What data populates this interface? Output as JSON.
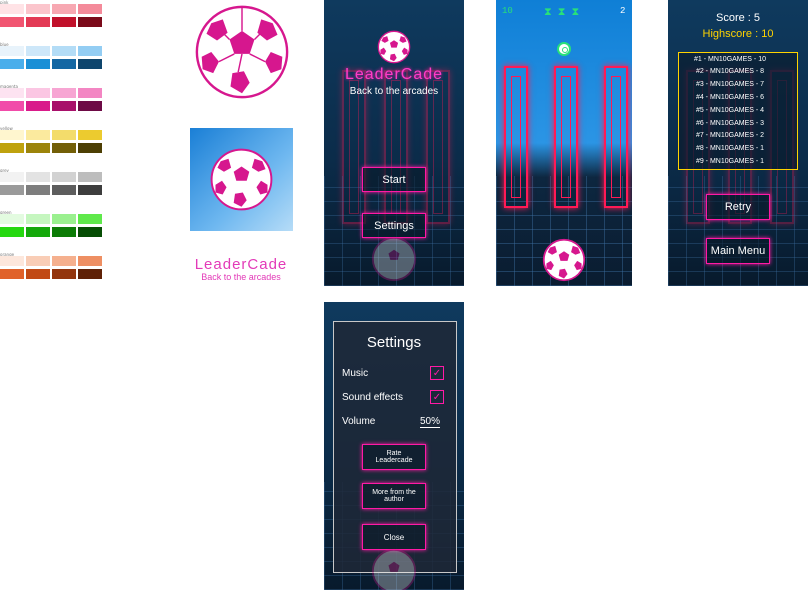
{
  "palette": {
    "groups": [
      {
        "title": "pink",
        "rows": [
          [
            "#ffe3e6",
            "#fbc5cc",
            "#f7a8b2",
            "#f48a9a"
          ],
          [
            "#f15571",
            "#e33a55",
            "#c1112b",
            "#7b0a1a"
          ]
        ]
      },
      {
        "title": "blue",
        "rows": [
          [
            "#e8f3fb",
            "#cde7f9",
            "#b3dcf6",
            "#93cdf3"
          ],
          [
            "#4aaeeb",
            "#1a8fd6",
            "#1467a3",
            "#0e456d"
          ]
        ]
      },
      {
        "title": "magenta",
        "rows": [
          [
            "#fde3f1",
            "#fbc6e3",
            "#f7a5d3",
            "#f386c3"
          ],
          [
            "#f14ca9",
            "#d91b8a",
            "#a8106a",
            "#6d0a45"
          ]
        ]
      },
      {
        "title": "yellow",
        "rows": [
          [
            "#fff6cf",
            "#fbea9e",
            "#f3dc6b",
            "#eccb2f"
          ],
          [
            "#bfa20e",
            "#9c840b",
            "#735f07",
            "#4d3f04"
          ]
        ]
      },
      {
        "title": "grey",
        "rows": [
          [
            "#f2f2f2",
            "#e3e3e3",
            "#d2d2d2",
            "#bdbdbd"
          ],
          [
            "#9a9a9a",
            "#7d7d7d",
            "#5d5d5d",
            "#3d3d3d"
          ]
        ]
      },
      {
        "title": "green",
        "rows": [
          [
            "#e3fbe0",
            "#c5f6bf",
            "#9af08f",
            "#5fe94b"
          ],
          [
            "#25d80f",
            "#14a80a",
            "#0c7c06",
            "#064d04"
          ]
        ]
      },
      {
        "title": "orange",
        "rows": [
          [
            "#fde7dc",
            "#f9cdb6",
            "#f5b08e",
            "#ee8f63"
          ],
          [
            "#e0622a",
            "#c14a15",
            "#93350c",
            "#5f2106"
          ]
        ]
      }
    ]
  },
  "branding": {
    "logo_title": "LeaderCade",
    "logo_subtitle": "Back to the arcades"
  },
  "menu_screen": {
    "title": "LeaderCade",
    "subtitle": "Back to the arcades",
    "start_label": "Start",
    "settings_label": "Settings"
  },
  "game_screen": {
    "left_counter": "10",
    "right_counter": "2",
    "lives_icons": [
      "hourglass-icon",
      "hourglass-icon",
      "hourglass-icon"
    ]
  },
  "score_screen": {
    "score_text": "Score : 5",
    "highscore_text": "Highscore : 10",
    "leaderboard": [
      "#1 - MN10GAMES - 10",
      "#2 - MN10GAMES - 8",
      "#3 - MN10GAMES - 7",
      "#4 - MN10GAMES - 6",
      "#5 - MN10GAMES - 4",
      "#6 - MN10GAMES - 3",
      "#7 - MN10GAMES - 2",
      "#8 - MN10GAMES - 1",
      "#9 - MN10GAMES - 1"
    ],
    "retry_label": "Retry",
    "main_menu_label": "Main Menu"
  },
  "settings_screen": {
    "title": "Settings",
    "music_label": "Music",
    "sound_label": "Sound effects",
    "volume_label": "Volume",
    "volume_value": "50%",
    "rate_label_1": "Rate",
    "rate_label_2": "Leadercade",
    "more_label_1": "More from the",
    "more_label_2": "author",
    "close_label": "Close"
  },
  "colors": {
    "neon_pink": "#ff1aa6",
    "neon_red": "#ff1a55",
    "score_yellow": "#ffd400",
    "counter_green": "#28e07a"
  }
}
